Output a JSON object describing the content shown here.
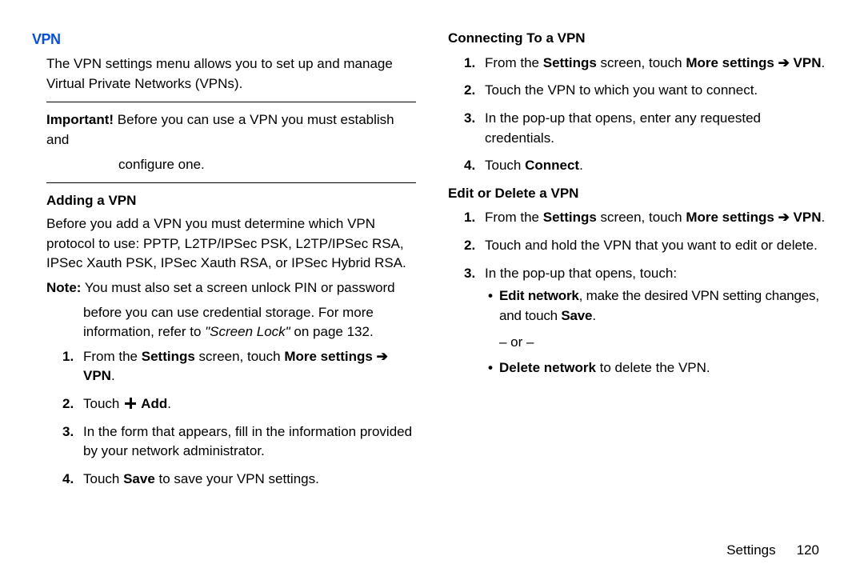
{
  "left": {
    "title": "VPN",
    "intro": "The VPN settings menu allows you to set up and manage Virtual Private Networks (VPNs).",
    "important_label": "Important!",
    "important_first": " Before you can use a VPN you must establish and",
    "important_rest": "configure one.",
    "adding_heading": "Adding a VPN",
    "adding_intro": "Before you add a VPN you must determine which VPN protocol to use: PPTP, L2TP/IPSec PSK, L2TP/IPSec RSA, IPSec Xauth PSK, IPSec Xauth RSA, or IPSec Hybrid RSA.",
    "note_label": "Note:",
    "note_first": " You must also set a screen unlock PIN or password",
    "note_rest1": "before you can use credential storage. For more",
    "note_rest2a": "information, refer to ",
    "note_rest2b": "\"Screen Lock\"",
    "note_rest2c": " on page 132.",
    "step1_a": "From the ",
    "step1_b": "Settings",
    "step1_c": " screen, touch ",
    "step1_d": "More settings ",
    "arrow": "➔",
    "step1_e": " VPN",
    "dot": ".",
    "step2_a": "Touch ",
    "step2_b": " Add",
    "step3": "In the form that appears, fill in the information provided by your network administrator.",
    "step4_a": "Touch ",
    "step4_b": "Save",
    "step4_c": " to save your VPN settings."
  },
  "right": {
    "connect_heading": "Connecting To a VPN",
    "c1_a": "From the ",
    "c1_b": "Settings",
    "c1_c": " screen, touch ",
    "c1_d": "More settings ",
    "c1_e": " VPN",
    "c2": "Touch the VPN to which you want to connect.",
    "c3": "In the pop-up that opens, enter any requested credentials.",
    "c4_a": "Touch ",
    "c4_b": "Connect",
    "edit_heading": "Edit or Delete a VPN",
    "e1_a": "From the ",
    "e1_b": "Settings",
    "e1_c": " screen, touch ",
    "e1_d": "More settings ",
    "e1_e": " VPN",
    "e2": "Touch and hold the VPN that you want to edit or delete.",
    "e3": "In the pop-up that opens, touch:",
    "bullet1_a": "Edit network",
    "bullet1_b": ", make the desired VPN setting changes, and touch ",
    "bullet1_c": "Save",
    "or": "– or –",
    "bullet2_a": "Delete network",
    "bullet2_b": " to delete the VPN."
  },
  "footer": {
    "section": "Settings",
    "page": "120"
  }
}
